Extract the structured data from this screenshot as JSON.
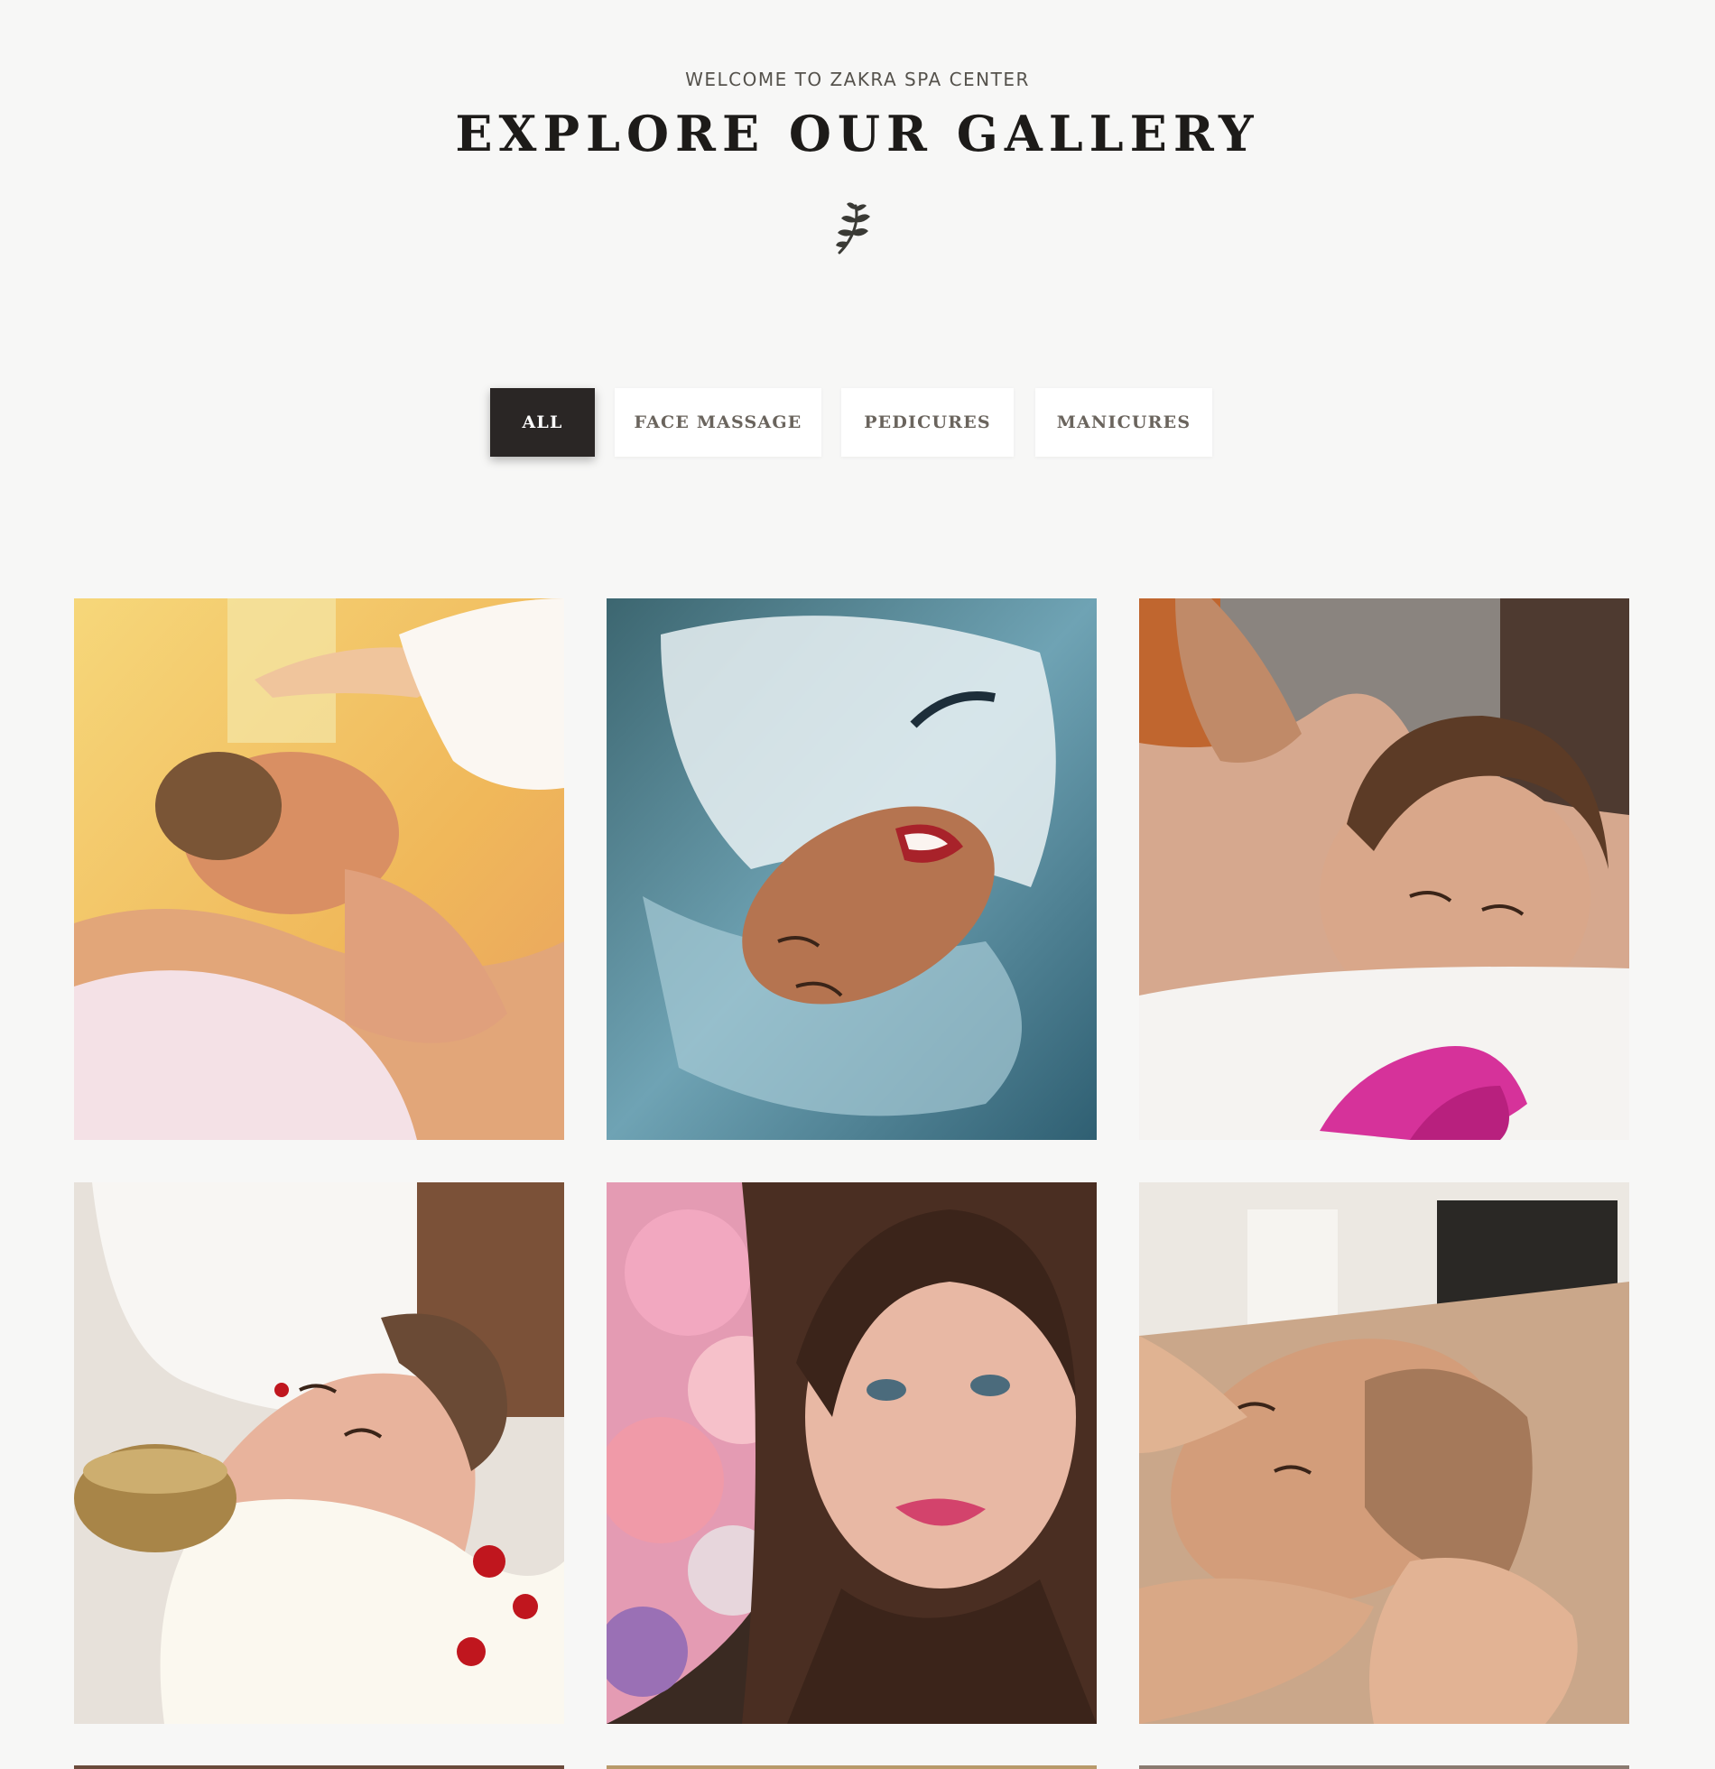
{
  "header": {
    "subtitle": "WELCOME TO ZAKRA SPA CENTER",
    "title": "EXPLORE OUR GALLERY",
    "divider_icon": "leaf-icon"
  },
  "filters": {
    "items": [
      {
        "label": "ALL",
        "active": true
      },
      {
        "label": "FACE MASSAGE",
        "active": false
      },
      {
        "label": "PEDICURES",
        "active": false
      },
      {
        "label": "MANICURES",
        "active": false
      }
    ]
  },
  "gallery": {
    "items": [
      {
        "alt": "Woman receiving a back massage on a towel"
      },
      {
        "alt": "Smiling woman floating in a bubbling pool"
      },
      {
        "alt": "Woman relaxing during a shoulder massage with orchid"
      },
      {
        "alt": "Woman relaxing with singing bowl and rose petals"
      },
      {
        "alt": "Portrait of woman with pink flowers"
      },
      {
        "alt": "Man receiving a face and neck massage"
      }
    ]
  },
  "colors": {
    "background": "#f7f7f6",
    "active_button": "#2a2625",
    "title_text": "#1d1b19"
  }
}
